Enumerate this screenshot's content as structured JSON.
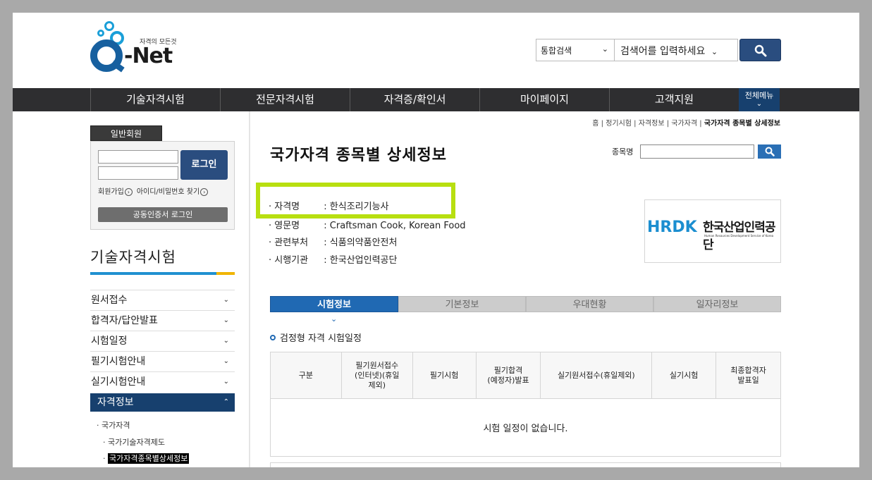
{
  "header": {
    "logo_slogan": "자격의 모든것",
    "logo_brand": "Q-Net",
    "search_scope": "통합검색",
    "search_placeholder": "검색어를 입력하세요",
    "search_button_icon": "search-icon"
  },
  "nav": {
    "items": [
      "기술자격시험",
      "전문자격시험",
      "자격증/확인서",
      "마이페이지",
      "고객지원"
    ],
    "all_menu": "전체메뉴"
  },
  "login": {
    "member_tab": "일반회원",
    "login_button": "로그인",
    "signup_link": "회원가입",
    "find_link": "아이디/비밀번호 찾기",
    "cert_login": "공동인증서 로그인"
  },
  "sidebar": {
    "title": "기술자격시험",
    "items": [
      {
        "label": "원서접수"
      },
      {
        "label": "합격자/답안발표"
      },
      {
        "label": "시험일정"
      },
      {
        "label": "필기시험안내"
      },
      {
        "label": "실기시험안내"
      },
      {
        "label": "자격정보"
      }
    ],
    "sub_items": [
      "국가자격",
      "국가기술자격제도",
      "국가자격종목별상세정보"
    ]
  },
  "breadcrumb": {
    "items": [
      "홈",
      "정기시험",
      "자격정보",
      "국가자격"
    ],
    "current": "국가자격 종목별 상세정보"
  },
  "content": {
    "page_title": "국가자격 종목별 상세정보",
    "item_search_label": "종목명",
    "info": {
      "name_label": "자격명",
      "name_value": ": 한식조리기능사",
      "eng_label": "영문명",
      "eng_value": ": Craftsman Cook, Korean Food",
      "dept_label": "관련부처",
      "dept_value": ": 식품의약품안전처",
      "org_label": "시행기관",
      "org_value": ": 한국산업인력공단"
    },
    "org_logo": {
      "mark": "HRDK",
      "korean_name": "한국산업인력공단",
      "english_name": "Human Resources Development Service of Korea"
    },
    "tabs": [
      "시험정보",
      "기본정보",
      "우대현황",
      "일자리정보"
    ],
    "section_title": "검정형 자격 시험일정",
    "table": {
      "headers": [
        "구분",
        "필기원서접수\n(인터넷)(휴일\n제외)",
        "필기시험",
        "필기합격\n(예정자)발표",
        "실기원서접수(휴일제외)",
        "실기시험",
        "최종합격자\n발표일"
      ],
      "empty_message": "시험 일정이 없습니다."
    }
  },
  "colors": {
    "nav_bg": "#2e2e30",
    "brand_blue": "#17406e",
    "tab_active": "#2069b3",
    "highlight": "#b8df10"
  }
}
